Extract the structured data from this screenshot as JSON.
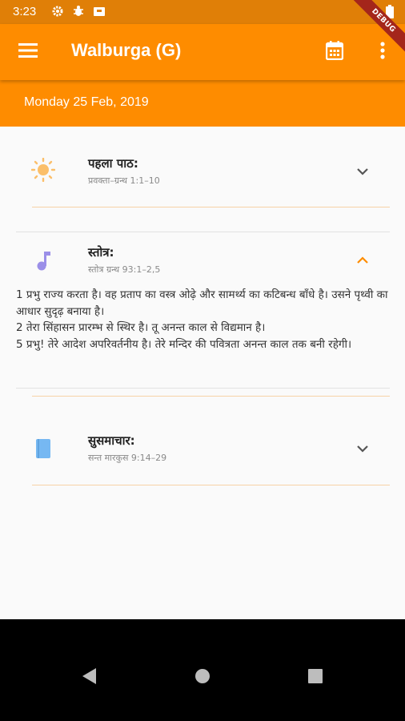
{
  "status_bar": {
    "time": "3:23",
    "icons": [
      "gear-icon",
      "bug-icon",
      "box-icon",
      "wifi-icon",
      "battery-icon"
    ]
  },
  "debug_banner": "DEBUG",
  "app_bar": {
    "title": "Walburga (G)",
    "icons": [
      "menu-icon",
      "calendar-icon",
      "more-vert-icon"
    ],
    "background_color": "#fe8c00"
  },
  "date_label": "Monday 25 Feb, 2019",
  "readings": [
    {
      "title": "पहला पाठ:",
      "reference": "प्रवक्ता–ग्रन्थ 1:1–10",
      "icon": "sun-icon",
      "icon_color": "#fbbf6a",
      "expanded": false
    },
    {
      "title": "स्तोत्र:",
      "reference": "स्तोत्र ग्रन्थ 93:1–2,5",
      "icon": "music-note-icon",
      "icon_color": "#9b8fe8",
      "expanded": true,
      "verses": [
        "1 प्रभु राज्य करता है। वह प्रताप का वस्त्र ओढ़े और सामर्थ्य का कटिबन्ध बाँधे है। उसने पृथ्वी का आधार सुदृढ़ बनाया है।",
        "2 तेरा सिंहासन प्रारम्भ से स्थिर है। तू अनन्त काल से विद्यमान है।",
        "5 प्रभु! तेरे आदेश अपरिवर्तनीय है। तेरे मन्दिर की पवित्रता अनन्त काल तक बनी रहेगी।"
      ]
    },
    {
      "title": "सुसमाचार:",
      "reference": "सन्त मारकुस 9:14–29",
      "icon": "book-icon",
      "icon_color": "#76b8f2",
      "expanded": false
    }
  ],
  "accent_color": "#fe8c00",
  "nav_bar": {
    "icons": [
      "back-icon",
      "home-icon",
      "recents-icon"
    ]
  }
}
